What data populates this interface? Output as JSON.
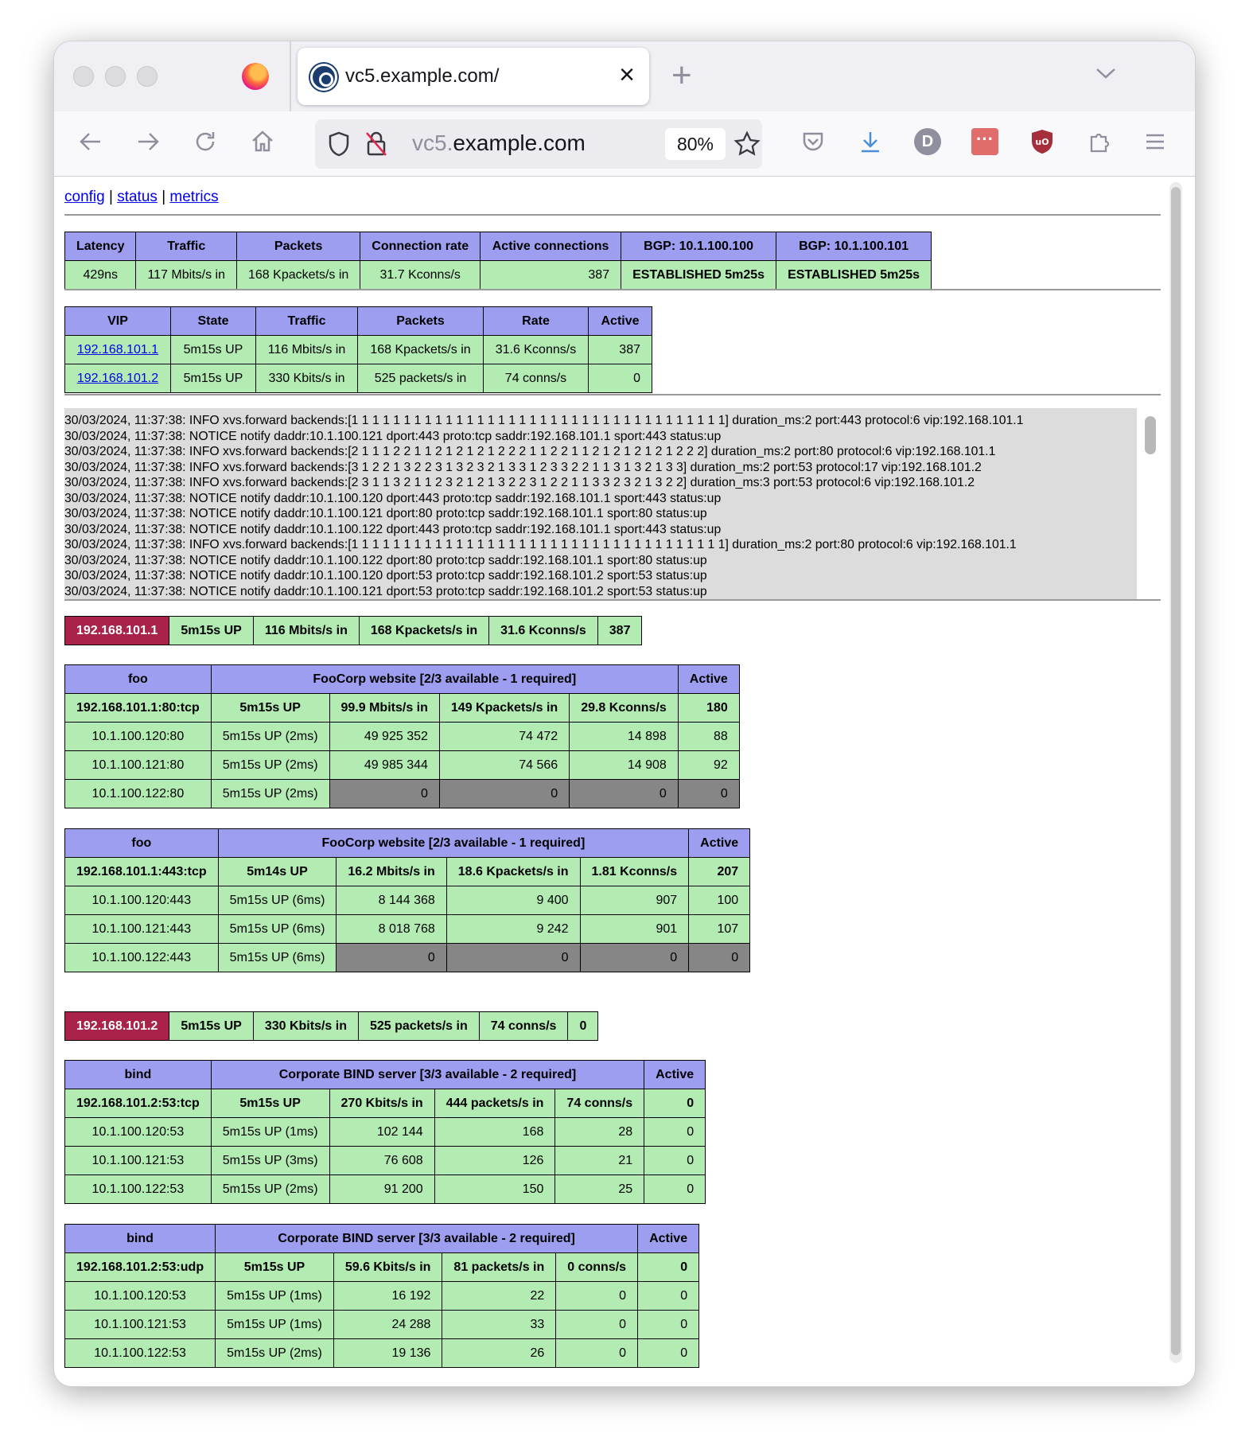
{
  "browser": {
    "tab_title": "vc5.example.com/",
    "url_host_dim": "vc5.",
    "url_host_main": "example.com",
    "zoom": "80%",
    "account_initial": "D"
  },
  "nav": {
    "config": "config",
    "sep1": "|",
    "status": "status",
    "sep2": "|",
    "metrics": "metrics"
  },
  "summary": {
    "headers": [
      "Latency",
      "Traffic",
      "Packets",
      "Connection rate",
      "Active connections",
      "BGP: 10.1.100.100",
      "BGP: 10.1.100.101"
    ],
    "values": [
      "429ns",
      "117 Mbits/s in",
      "168 Kpackets/s in",
      "31.7 Kconns/s",
      "387",
      "ESTABLISHED 5m25s",
      "ESTABLISHED 5m25s"
    ]
  },
  "vips": {
    "headers": [
      "VIP",
      "State",
      "Traffic",
      "Packets",
      "Rate",
      "Active"
    ],
    "rows": [
      [
        "192.168.101.1",
        "5m15s UP",
        "116 Mbits/s in",
        "168 Kpackets/s in",
        "31.6 Kconns/s",
        "387"
      ],
      [
        "192.168.101.2",
        "5m15s UP",
        "330 Kbits/s in",
        "525 packets/s in",
        "74 conns/s",
        "0"
      ]
    ]
  },
  "log": [
    "30/03/2024, 11:37:38: INFO xvs.forward backends:[1 1 1 1 1 1 1 1 1 1 1 1 1 1 1 1 1 1 1 1 1 1 1 1 1 1 1 1 1 1 1 1 1 1 1 1] duration_ms:2 port:443 protocol:6 vip:192.168.101.1",
    "30/03/2024, 11:37:38: NOTICE notify daddr:10.1.100.121 dport:443 proto:tcp saddr:192.168.101.1 sport:443 status:up",
    "30/03/2024, 11:37:38: INFO xvs.forward backends:[2 1 1 1 2 2 1 1 2 1 2 1 2 1 2 2 2 1 1 2 2 1 1 2 1 2 1 2 1 2 1 2 2 2] duration_ms:2 port:80 protocol:6 vip:192.168.101.1",
    "30/03/2024, 11:37:38: INFO xvs.forward backends:[3 1 2 2 1 3 2 2 3 1 3 2 3 2 1 3 3 1 2 3 3 2 2 1 1 3 1 3 2 1 3 3] duration_ms:2 port:53 protocol:17 vip:192.168.101.2",
    "30/03/2024, 11:37:38: INFO xvs.forward backends:[2 3 1 1 3 2 1 1 2 3 2 1 2 1 3 2 2 3 1 2 2 1 1 3 3 2 3 2 1 3 2 2] duration_ms:3 port:53 protocol:6 vip:192.168.101.2",
    "30/03/2024, 11:37:38: NOTICE notify daddr:10.1.100.120 dport:443 proto:tcp saddr:192.168.101.1 sport:443 status:up",
    "30/03/2024, 11:37:38: NOTICE notify daddr:10.1.100.121 dport:80 proto:tcp saddr:192.168.101.1 sport:80 status:up",
    "30/03/2024, 11:37:38: NOTICE notify daddr:10.1.100.122 dport:443 proto:tcp saddr:192.168.101.1 sport:443 status:up",
    "30/03/2024, 11:37:38: INFO xvs.forward backends:[1 1 1 1 1 1 1 1 1 1 1 1 1 1 1 1 1 1 1 1 1 1 1 1 1 1 1 1 1 1 1 1 1 1 1 1] duration_ms:2 port:80 protocol:6 vip:192.168.101.1",
    "30/03/2024, 11:37:38: NOTICE notify daddr:10.1.100.122 dport:80 proto:tcp saddr:192.168.101.1 sport:80 status:up",
    "30/03/2024, 11:37:38: NOTICE notify daddr:10.1.100.120 dport:53 proto:tcp saddr:192.168.101.2 sport:53 status:up",
    "30/03/2024, 11:37:38: NOTICE notify daddr:10.1.100.121 dport:53 proto:tcp saddr:192.168.101.2 sport:53 status:up"
  ],
  "vip1": {
    "bar": [
      "192.168.101.1",
      "5m15s UP",
      "116 Mbits/s in",
      "168 Kpackets/s in",
      "31.6 Kconns/s",
      "387"
    ],
    "services": [
      {
        "name": "foo",
        "desc": "FooCorp website [2/3 available - 1 required]",
        "active_label": "Active",
        "summary": [
          "192.168.101.1:80:tcp",
          "5m15s UP",
          "99.9 Mbits/s in",
          "149 Kpackets/s in",
          "29.8 Kconns/s",
          "180"
        ],
        "backends": [
          [
            "10.1.100.120:80",
            "5m15s UP (2ms)",
            "49 925 352",
            "74 472",
            "14 898",
            "88"
          ],
          [
            "10.1.100.121:80",
            "5m15s UP (2ms)",
            "49 985 344",
            "74 566",
            "14 908",
            "92"
          ],
          [
            "10.1.100.122:80",
            "5m15s UP (2ms)",
            "0",
            "0",
            "0",
            "0"
          ]
        ]
      },
      {
        "name": "foo",
        "desc": "FooCorp website [2/3 available - 1 required]",
        "active_label": "Active",
        "summary": [
          "192.168.101.1:443:tcp",
          "5m14s UP",
          "16.2 Mbits/s in",
          "18.6 Kpackets/s in",
          "1.81 Kconns/s",
          "207"
        ],
        "backends": [
          [
            "10.1.100.120:443",
            "5m15s UP (6ms)",
            "8 144 368",
            "9 400",
            "907",
            "100"
          ],
          [
            "10.1.100.121:443",
            "5m15s UP (6ms)",
            "8 018 768",
            "9 242",
            "901",
            "107"
          ],
          [
            "10.1.100.122:443",
            "5m15s UP (6ms)",
            "0",
            "0",
            "0",
            "0"
          ]
        ]
      }
    ]
  },
  "vip2": {
    "bar": [
      "192.168.101.2",
      "5m15s UP",
      "330 Kbits/s in",
      "525 packets/s in",
      "74 conns/s",
      "0"
    ],
    "services": [
      {
        "name": "bind",
        "desc": "Corporate BIND server [3/3 available - 2 required]",
        "active_label": "Active",
        "summary": [
          "192.168.101.2:53:tcp",
          "5m15s UP",
          "270 Kbits/s in",
          "444 packets/s in",
          "74 conns/s",
          "0"
        ],
        "backends": [
          [
            "10.1.100.120:53",
            "5m15s UP (1ms)",
            "102 144",
            "168",
            "28",
            "0"
          ],
          [
            "10.1.100.121:53",
            "5m15s UP (3ms)",
            "76 608",
            "126",
            "21",
            "0"
          ],
          [
            "10.1.100.122:53",
            "5m15s UP (2ms)",
            "91 200",
            "150",
            "25",
            "0"
          ]
        ]
      },
      {
        "name": "bind",
        "desc": "Corporate BIND server [3/3 available - 2 required]",
        "active_label": "Active",
        "summary": [
          "192.168.101.2:53:udp",
          "5m15s UP",
          "59.6 Kbits/s in",
          "81 packets/s in",
          "0 conns/s",
          "0"
        ],
        "backends": [
          [
            "10.1.100.120:53",
            "5m15s UP (1ms)",
            "16 192",
            "22",
            "0",
            "0"
          ],
          [
            "10.1.100.121:53",
            "5m15s UP (1ms)",
            "24 288",
            "33",
            "0",
            "0"
          ],
          [
            "10.1.100.122:53",
            "5m15s UP (2ms)",
            "19 136",
            "26",
            "0",
            "0"
          ]
        ]
      }
    ]
  },
  "colors": {
    "header_bg": "#9e9ef0",
    "up_bg": "#b2ecb2",
    "down_bg": "#868686",
    "vip_bg": "#a82249"
  }
}
